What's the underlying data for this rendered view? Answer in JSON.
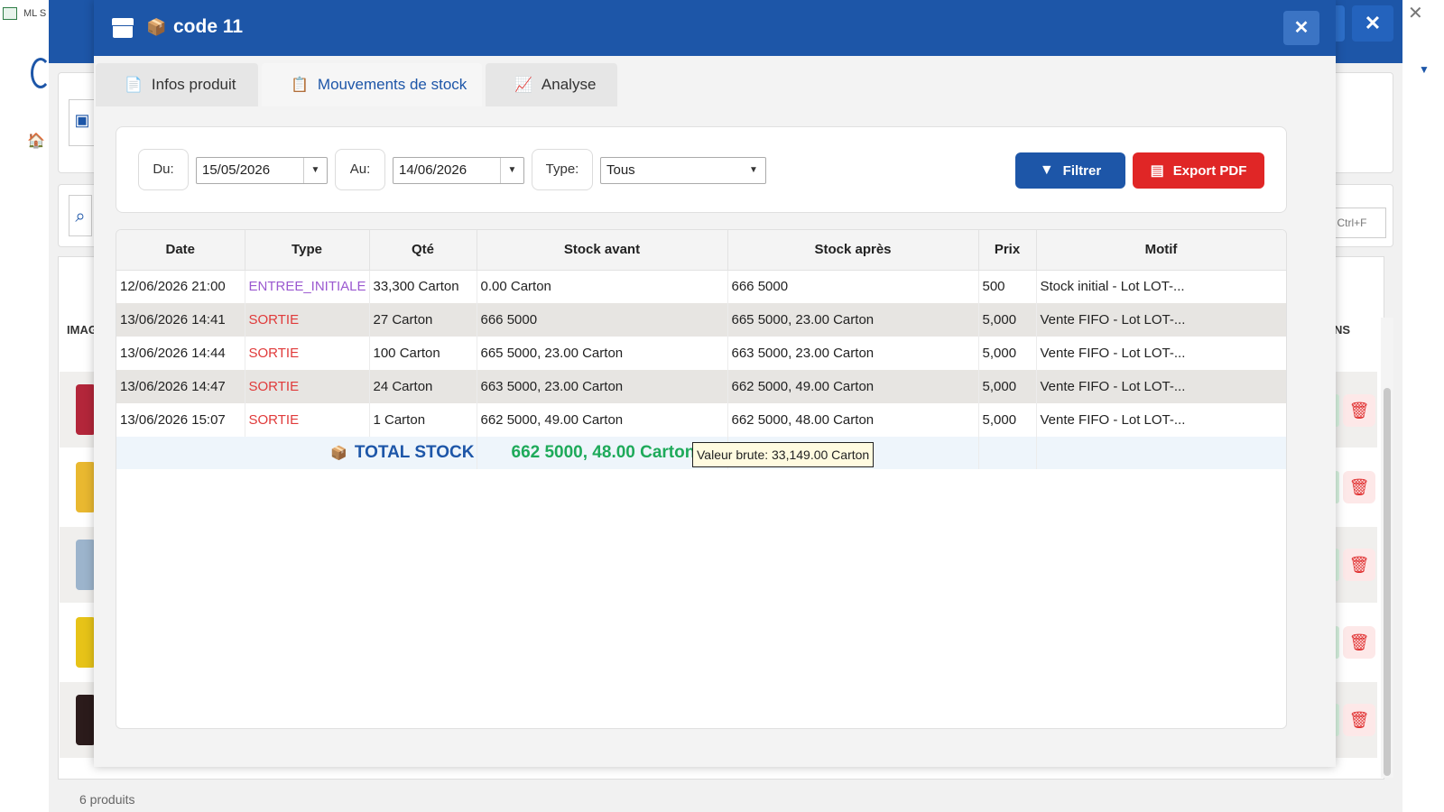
{
  "background": {
    "window_title": "ML S",
    "search_shortcut": "Ctrl+F",
    "column_image": "IMAG",
    "column_actions": "NS",
    "product_count": "6 produits"
  },
  "modal": {
    "title": "code 11",
    "close_icon": "close-icon",
    "tabs": [
      {
        "label": "Infos produit",
        "icon": "document-icon"
      },
      {
        "label": "Mouvements de stock",
        "icon": "clipboard-icon",
        "active": true
      },
      {
        "label": "Analyse",
        "icon": "chart-icon"
      }
    ],
    "filters": {
      "from_label": "Du:",
      "from_value": "15/05/2026",
      "to_label": "Au:",
      "to_value": "14/06/2026",
      "type_label": "Type:",
      "type_value": "Tous",
      "filter_button": "Filtrer",
      "export_button": "Export PDF"
    },
    "table": {
      "headers": [
        "Date",
        "Type",
        "Qté",
        "Stock avant",
        "Stock après",
        "Prix",
        "Motif"
      ],
      "rows": [
        {
          "date": "12/06/2026 21:00",
          "type": "ENTREE_INITIALE",
          "qty": "33,300 Carton",
          "before": "0.00 Carton",
          "after": "666 5000",
          "price": "500",
          "reason": "Stock initial - Lot LOT-..."
        },
        {
          "date": "13/06/2026 14:41",
          "type": "SORTIE",
          "qty": "27 Carton",
          "before": "666 5000",
          "after": "665 5000, 23.00 Carton",
          "price": "5,000",
          "reason": "Vente FIFO - Lot LOT-..."
        },
        {
          "date": "13/06/2026 14:44",
          "type": "SORTIE",
          "qty": "100 Carton",
          "before": "665 5000, 23.00 Carton",
          "after": "663 5000, 23.00 Carton",
          "price": "5,000",
          "reason": "Vente FIFO - Lot LOT-..."
        },
        {
          "date": "13/06/2026 14:47",
          "type": "SORTIE",
          "qty": "24 Carton",
          "before": "663 5000, 23.00 Carton",
          "after": "662 5000, 49.00 Carton",
          "price": "5,000",
          "reason": "Vente FIFO - Lot LOT-..."
        },
        {
          "date": "13/06/2026 15:07",
          "type": "SORTIE",
          "qty": "1 Carton",
          "before": "662 5000, 49.00 Carton",
          "after": "662 5000, 48.00 Carton",
          "price": "5,000",
          "reason": "Vente FIFO - Lot LOT-..."
        }
      ],
      "total_label": "TOTAL STOCK",
      "total_value": "662 5000, 48.00 Carton"
    },
    "tooltip": "Valeur brute: 33,149.00 Carton"
  },
  "colors": {
    "brand": "#1d56a8",
    "danger": "#e02626",
    "sortie": "#e03a3a",
    "entree": "#9b59d0",
    "total": "#1eaa5a"
  }
}
